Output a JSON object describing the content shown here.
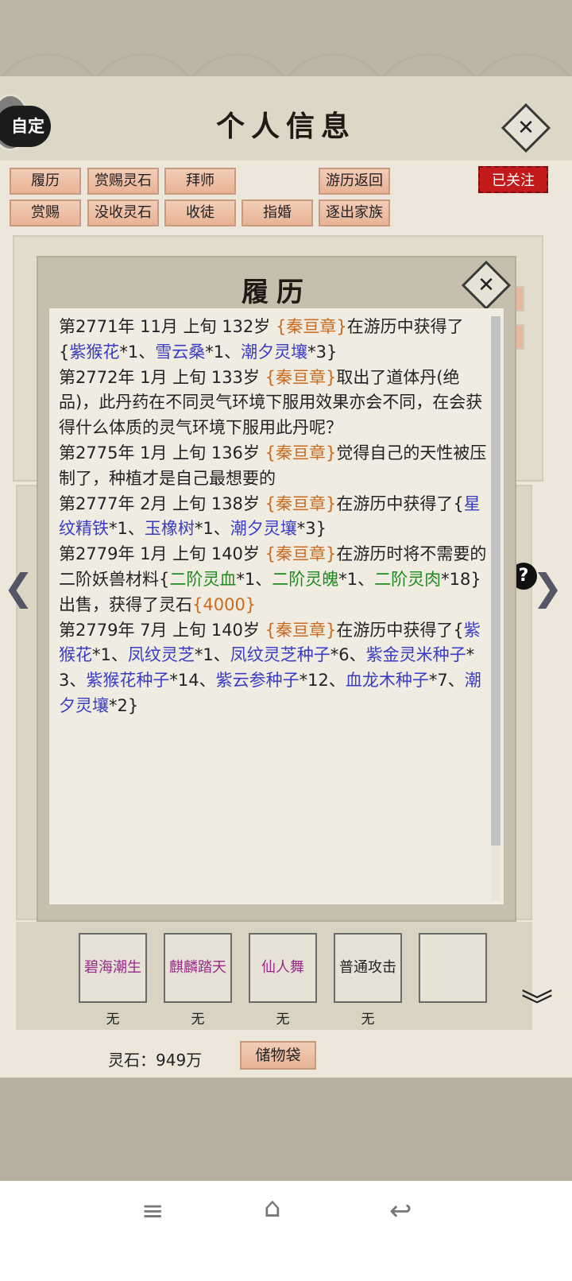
{
  "header": {
    "title": "个人信息",
    "auto_badge": "自定",
    "close_glyph": "✕"
  },
  "actions_row1": [
    "履历",
    "赏赐灵石",
    "拜师",
    "游历返回"
  ],
  "actions_row2": [
    "赏赐",
    "没收灵石",
    "收徒",
    "指婚",
    "逐出家族"
  ],
  "followed_label": "已关注",
  "modal": {
    "title": "履历",
    "close_glyph": "✕",
    "entries": [
      {
        "head": "第2771年 11月 上旬  132岁 ",
        "name": "{秦亘章}",
        "text": "在游历中获得了{",
        "items": [
          [
            "紫猴花",
            "*1、"
          ],
          [
            "雪云桑",
            "*1、"
          ],
          [
            "潮夕灵壤",
            "*3}"
          ]
        ]
      },
      {
        "head": "第2772年 1月 上旬  133岁 ",
        "name": "{秦亘章}",
        "text": "取出了道体丹(绝品)，此丹药在不同灵气环境下服用效果亦会不同，在会获得什么体质的灵气环境下服用此丹呢？"
      },
      {
        "head": "第2775年 1月 上旬  136岁 ",
        "name": "{秦亘章}",
        "text": "觉得自己的天性被压制了，种植才是自己最想要的"
      },
      {
        "head": "第2777年 2月 上旬  138岁 ",
        "name": "{秦亘章}",
        "text": "在游历中获得了{",
        "items": [
          [
            "星纹精铁",
            "*1、"
          ],
          [
            "玉橡树",
            "*1、"
          ],
          [
            "潮夕灵壤",
            "*3}"
          ]
        ]
      },
      {
        "head": "第2779年 1月 上旬  140岁 ",
        "name": "{秦亘章}",
        "text": "在游历时将不需要的二阶妖兽材料{",
        "green_items": [
          [
            "二阶灵血",
            "*1、"
          ],
          [
            "二阶灵魄",
            "*1、"
          ],
          [
            "二阶灵肉",
            "*18}"
          ]
        ],
        "tail": "出售，获得了灵石",
        "reward": "{4000}"
      },
      {
        "head": "第2779年 7月 上旬  140岁 ",
        "name": "{秦亘章}",
        "text": "在游历中获得了{",
        "items": [
          [
            "紫猴花",
            "*1、"
          ],
          [
            "凤纹灵芝",
            "*1、"
          ],
          [
            "凤纹灵芝种子",
            "*6、"
          ],
          [
            "紫金灵米种子",
            "*3、"
          ],
          [
            "紫猴花种子",
            "*14、"
          ],
          [
            "紫云参种子",
            "*12、"
          ],
          [
            "血龙木种子",
            "*7、"
          ],
          [
            "潮夕灵壤",
            "*2}"
          ]
        ]
      }
    ]
  },
  "skills": [
    {
      "name": "碧海潮生",
      "value": "无",
      "color": "#9a2a8a"
    },
    {
      "name": "麒麟踏天",
      "value": "无",
      "color": "#9a2a8a"
    },
    {
      "name": "仙人舞",
      "value": "无",
      "color": "#9a2a8a"
    },
    {
      "name": "普通攻击",
      "value": "无",
      "color": "#222222"
    },
    {
      "name": "",
      "value": "",
      "color": "#222222"
    }
  ],
  "footer": {
    "stones": "灵石：949万",
    "bag_button": "储物袋"
  },
  "nav": {
    "left_arrow": "❮",
    "right_arrow": "❯",
    "help": "?",
    "expand": "︾",
    "menu_icon": "≡",
    "home_icon": "⌂",
    "back_icon": "↩"
  }
}
